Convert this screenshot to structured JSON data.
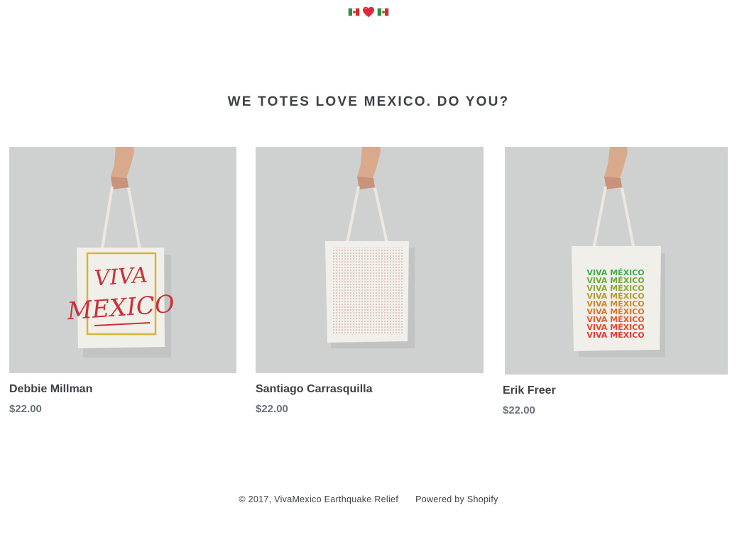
{
  "header": {
    "icons": [
      "mexico-flag-icon",
      "red-heart-icon",
      "mexico-flag-icon"
    ]
  },
  "collection": {
    "title": "WE TOTES LOVE MEXICO. DO YOU?"
  },
  "products": [
    {
      "name": "Debbie Millman",
      "price": "$22.00",
      "image_text": [
        "VIVA",
        "MEXICO"
      ]
    },
    {
      "name": "Santiago Carrasquilla",
      "price": "$22.00"
    },
    {
      "name": "Erik Freer",
      "price": "$22.00",
      "image_text": [
        "VIVA MÉXICO",
        "VIVA MÉXICO",
        "VIVA MÉXICO",
        "VIVA MÉXICO",
        "VIVA MÉXICO",
        "VIVA MÉXICO",
        "VIVA MÉXICO",
        "VIVA MÉXICO",
        "VIVA MÉXICO"
      ]
    }
  ],
  "footer": {
    "copyright": "© 2017, VivaMexico Earthquake Relief",
    "powered_by": "Powered by Shopify"
  },
  "colors": {
    "text": "#3d4246",
    "price": "#69727b",
    "photo_bg": "#cfd1d1",
    "heart": "#e0263a",
    "flag_green": "#2e8b4a",
    "flag_red": "#d22a2a"
  }
}
